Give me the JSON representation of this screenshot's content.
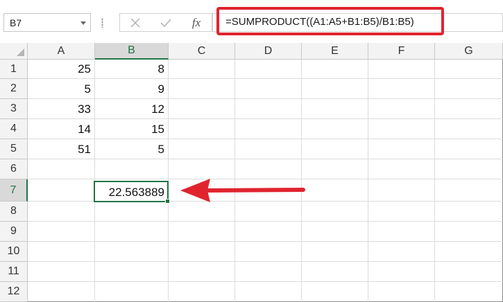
{
  "name_box": {
    "value": "B7"
  },
  "formula_bar": {
    "cancel_icon": "close-icon",
    "enter_icon": "check-icon",
    "function_label": "fx",
    "formula": "=SUMPRODUCT((A1:A5+B1:B5)/B1:B5)"
  },
  "columns": [
    "A",
    "B",
    "C",
    "D",
    "E",
    "F",
    "G"
  ],
  "rows": [
    "1",
    "2",
    "3",
    "4",
    "5",
    "6",
    "7",
    "8",
    "9",
    "10",
    "11",
    "12"
  ],
  "cells": {
    "A1": "25",
    "B1": "8",
    "A2": "5",
    "B2": "9",
    "A3": "33",
    "B3": "12",
    "A4": "14",
    "B4": "15",
    "A5": "51",
    "B5": "5",
    "B7": "22.563889"
  },
  "annotation": {
    "arrow_color": "#e0242f",
    "highlight_color": "#e0242f"
  },
  "accent": "#217346"
}
